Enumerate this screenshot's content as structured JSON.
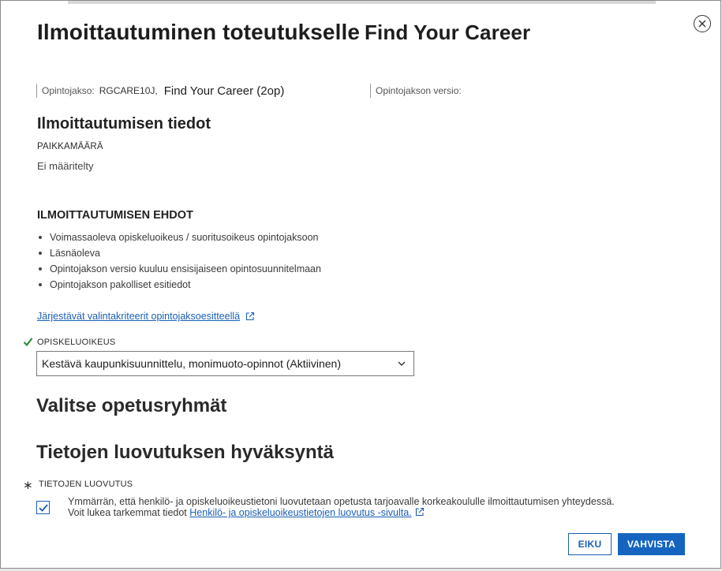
{
  "dialog": {
    "title": "Ilmoittautuminen toteutukselle",
    "course_name_title": "Find Your Career"
  },
  "course_info": {
    "course_label": "Opintojakso:",
    "course_code": "RGCARE10J,",
    "course_name": "Find Your Career (2op)",
    "version_label": "Opintojakson versio:"
  },
  "enrollment_info": {
    "heading": "Ilmoittautumisen tiedot",
    "seats_label": "PAIKKAMÄÄRÄ",
    "seats_value": "Ei määritelty"
  },
  "conditions": {
    "heading": "ILMOITTAUTUMISEN EHDOT",
    "items": [
      "Voimassaoleva opiskeluoikeus / suoritusoikeus opintojaksoon",
      "Läsnäoleva",
      "Opintojakson versio kuuluu ensisijaiseen opintosuunnitelmaan",
      "Opintojakson pakolliset esitiedot"
    ],
    "criteria_link": "Järjestävät valintakriteerit opintojaksoesitteellä"
  },
  "study_right": {
    "label": "OPISKELUOIKEUS",
    "selected": "Kestävä kaupunkisuunnittelu, monimuoto-opinnot (Aktiivinen)"
  },
  "groups": {
    "heading": "Valitse opetusryhmät"
  },
  "consent": {
    "heading": "Tietojen luovutuksen hyväksyntä",
    "required_mark": "∗",
    "label": "TIETOJEN LUOVUTUS",
    "checked": true,
    "text_line1": "Ymmärrän, että henkilö- ja opiskeluoikeustietoni luovutetaan opetusta tarjoavalle korkeakoululle ilmoittautumisen yhteydessä.",
    "text_line2": "Voit lukea tarkemmat tiedot",
    "link_text": "Henkilö- ja opiskeluoikeustietojen luovutus -sivulta."
  },
  "buttons": {
    "cancel": "EIKU",
    "confirm": "VAHVISTA"
  },
  "colors": {
    "accent": "#1565c0",
    "link": "#1a5fb4",
    "success": "#2e8b3a"
  }
}
